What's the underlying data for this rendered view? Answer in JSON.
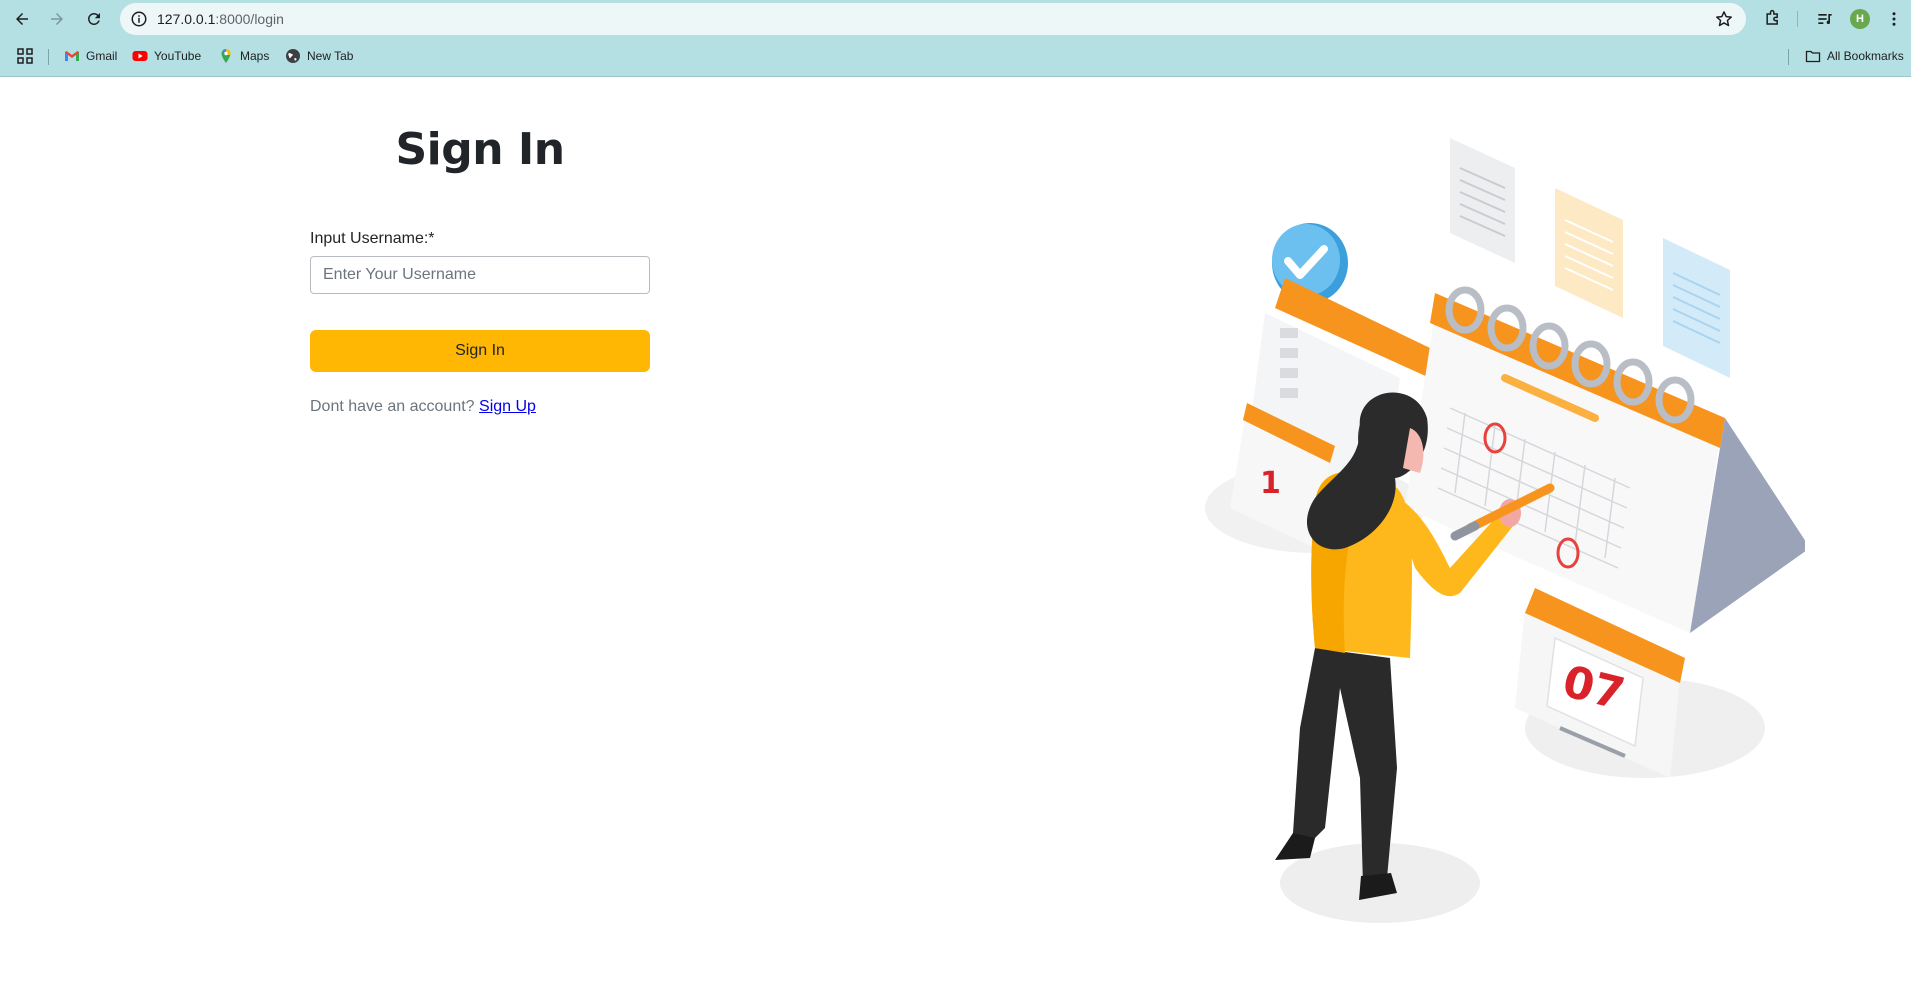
{
  "browser": {
    "url_host": "127.0.0.1",
    "url_path": ":8000/login",
    "profile_initial": "H",
    "bookmarks": [
      {
        "label": "Gmail",
        "icon": "gmail-icon"
      },
      {
        "label": "YouTube",
        "icon": "youtube-icon"
      },
      {
        "label": "Maps",
        "icon": "maps-icon"
      },
      {
        "label": "New Tab",
        "icon": "globe-icon"
      }
    ],
    "all_bookmarks_label": "All Bookmarks"
  },
  "login": {
    "title": "Sign In",
    "username_label": "Input Username:*",
    "username_placeholder": "Enter Your Username",
    "username_value": "",
    "submit_label": "Sign In",
    "signup_prompt": "Dont have an account?",
    "signup_link": "Sign Up"
  },
  "illustration": {
    "calendar_day": "07",
    "calendar_day_partial": "1"
  },
  "colors": {
    "accent": "#ffb703",
    "chrome_bg": "#b4dfe3",
    "link": "#0000ee"
  }
}
